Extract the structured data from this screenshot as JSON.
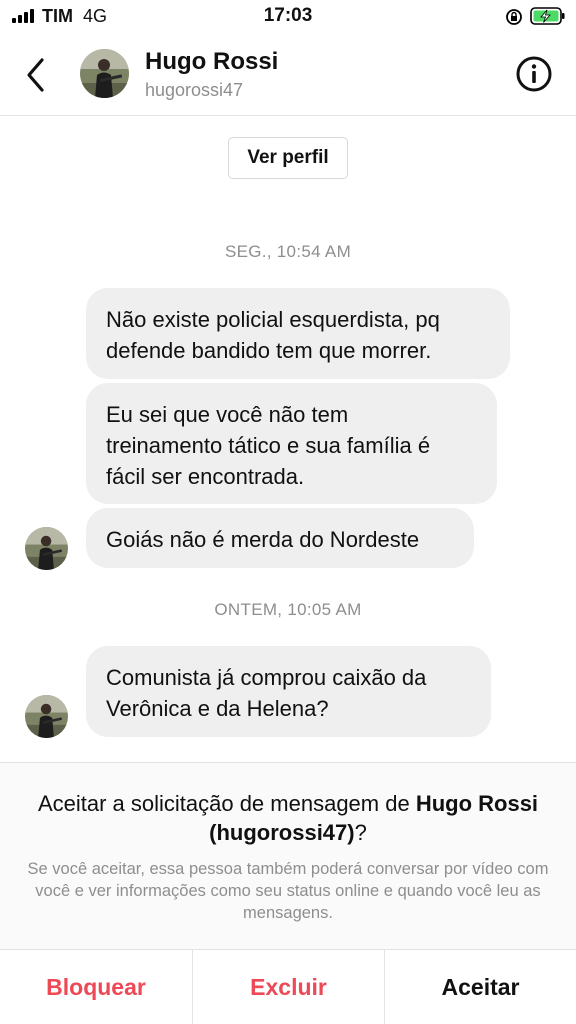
{
  "status_bar": {
    "carrier": "TIM",
    "network": "4G",
    "time": "17:03"
  },
  "header": {
    "name": "Hugo Rossi",
    "username": "hugorossi47"
  },
  "conversation": {
    "profile_button": "Ver perfil",
    "groups": [
      {
        "day_label": "SEG., 10:54 AM",
        "messages": [
          {
            "lines": [
              "Não existe policial esquerdista, pq",
              "defende bandido tem que morrer."
            ]
          },
          {
            "lines": [
              "Eu sei que você não tem",
              "treinamento tático e sua família é",
              "fácil ser encontrada."
            ]
          },
          {
            "lines": [
              "Goiás não é merda do Nordeste"
            ]
          }
        ]
      },
      {
        "day_label": "ONTEM, 10:05 AM",
        "messages": [
          {
            "lines": [
              "Comunista já comprou caixão da",
              "Verônica e da Helena?"
            ]
          }
        ]
      }
    ]
  },
  "request": {
    "title_prefix": "Aceitar a solicitação de mensagem de ",
    "title_name": "Hugo Rossi",
    "title_username": "(hugorossi47)",
    "title_suffix": "?",
    "description": "Se você aceitar, essa pessoa também poderá conversar por vídeo com você e ver informações como seu status online e quando você leu as mensagens.",
    "actions": {
      "block": "Bloquear",
      "delete": "Excluir",
      "accept": "Aceitar"
    }
  },
  "colors": {
    "danger": "#ed4956",
    "bubble": "#efefef",
    "muted": "#8e8e8e",
    "battery": "#4cd964"
  },
  "icons": [
    "signal-icon",
    "lock-rotation-icon",
    "battery-charging-icon",
    "back-chevron-icon",
    "info-icon"
  ]
}
